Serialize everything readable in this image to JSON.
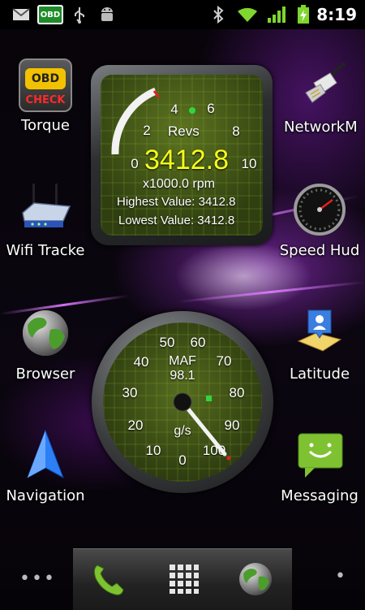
{
  "status_bar": {
    "icons": [
      "gmail-icon",
      "obd-icon",
      "usb-icon",
      "android-debug-icon",
      "bluetooth-icon",
      "wifi-icon",
      "signal-icon",
      "battery-charging-icon"
    ],
    "obd_label": "OBD",
    "time": "8:19"
  },
  "apps": {
    "torque": "Torque",
    "network": "NetworkM",
    "wifi_tracker": "Wifi Tracke",
    "speed_hud": "Speed Hud",
    "browser": "Browser",
    "latitude": "Latitude",
    "navigation": "Navigation",
    "messaging": "Messaging"
  },
  "revs_gauge": {
    "label": "Revs",
    "value": "3412.8",
    "unit": "x1000.0 rpm",
    "highest": "Highest Value: 3412.8",
    "lowest": "Lowest Value: 3412.8",
    "ticks": [
      "0",
      "2",
      "4",
      "6",
      "8",
      "10"
    ]
  },
  "maf_gauge": {
    "label": "MAF",
    "value": "98.1",
    "unit": "g/s",
    "ticks": [
      "0",
      "10",
      "20",
      "30",
      "40",
      "50",
      "60",
      "70",
      "80",
      "90",
      "100"
    ]
  },
  "obd_check_icon": {
    "top": "OBD",
    "bottom": "CHECK"
  },
  "dock": {
    "left": "•••",
    "right": "•"
  },
  "colors": {
    "accent_yellow": "#f6ff1a",
    "needle_red": "#e02020",
    "signal_green": "#7fd62e"
  }
}
